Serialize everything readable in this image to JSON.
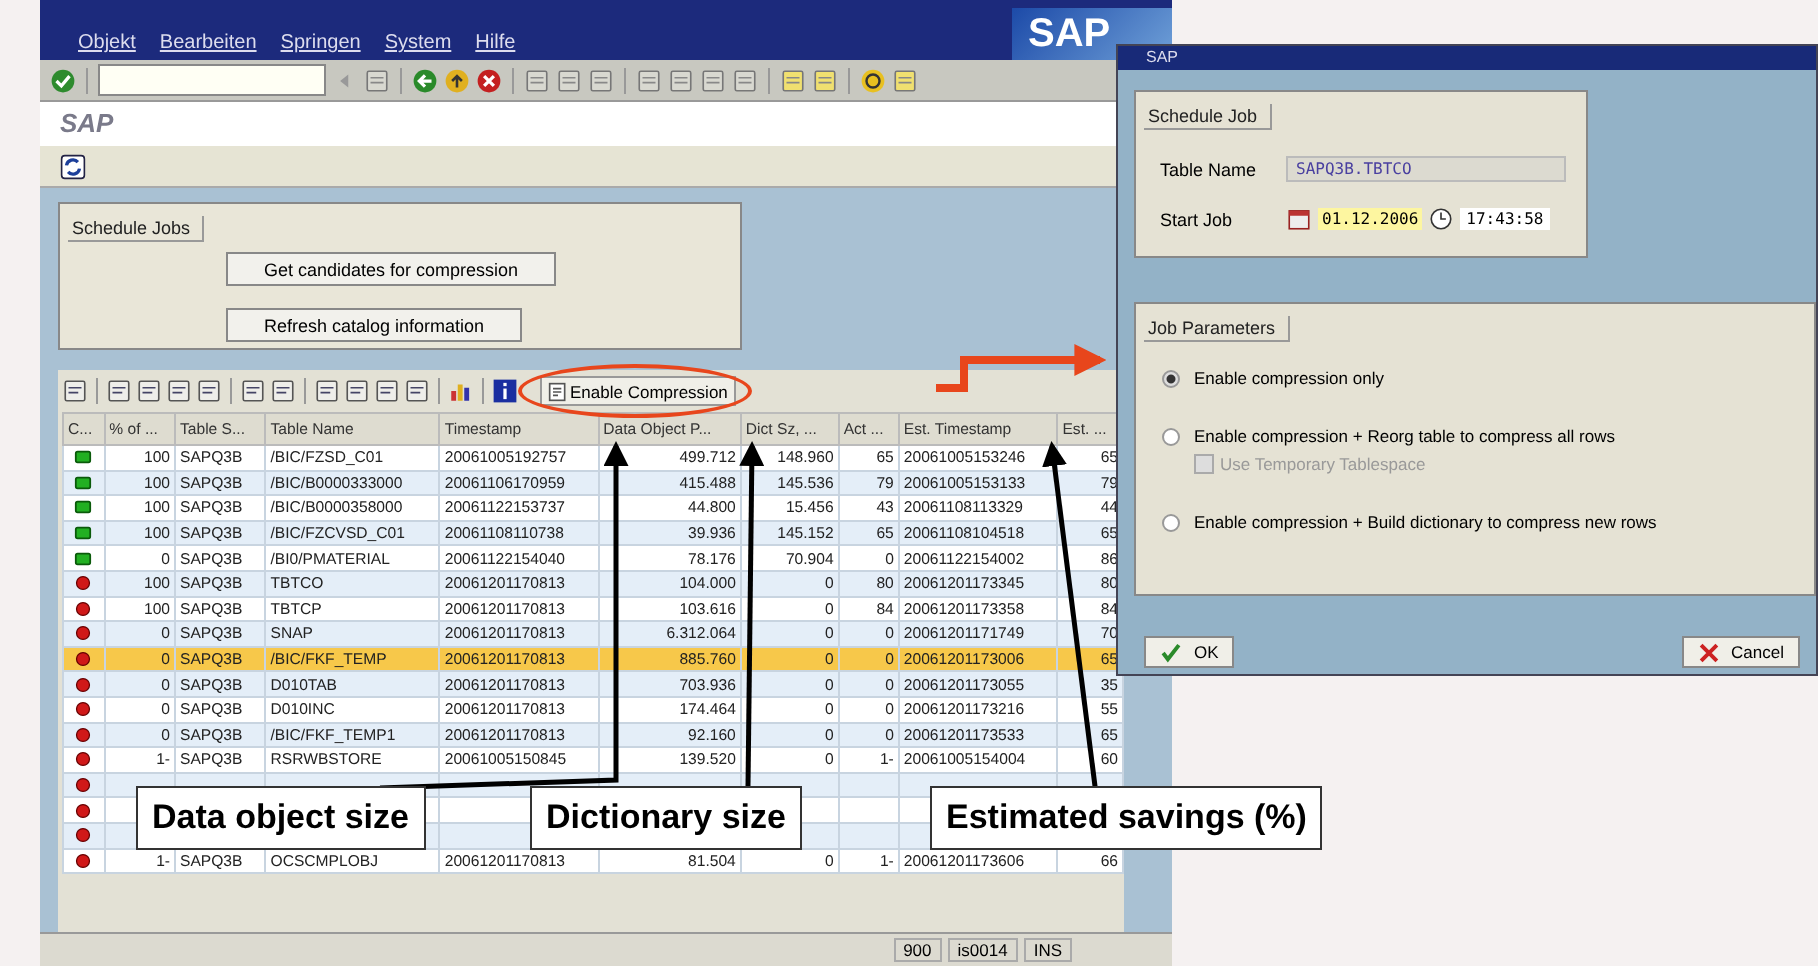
{
  "main_window": {
    "menu": [
      "Objekt",
      "Bearbeiten",
      "Springen",
      "System",
      "Hilfe"
    ],
    "logo": "SAP",
    "title": "SAP",
    "group": {
      "title": "Schedule Jobs",
      "buttons": [
        "Get candidates for compression",
        "Refresh catalog information"
      ]
    },
    "table_toolbar": {
      "action": "Enable Compression"
    },
    "table": {
      "columns": [
        "C...",
        "% of ...",
        "Table S...",
        "Table Name",
        "Timestamp",
        "Data Object P...",
        "Dict Sz, ...",
        "Act ...",
        "Est. Timestamp",
        "Est. ..."
      ],
      "rows": [
        {
          "kind": "ok",
          "selected": false,
          "cells": [
            "100",
            "SAPQ3B",
            "/BIC/FZSD_C01",
            "20061005192757",
            "499.712",
            "148.960",
            "65",
            "20061005153246",
            "65"
          ]
        },
        {
          "kind": "ok",
          "selected": false,
          "cells": [
            "100",
            "SAPQ3B",
            "/BIC/B0000333000",
            "20061106170959",
            "415.488",
            "145.536",
            "79",
            "20061005153133",
            "79"
          ]
        },
        {
          "kind": "ok",
          "selected": false,
          "cells": [
            "100",
            "SAPQ3B",
            "/BIC/B0000358000",
            "20061122153737",
            "44.800",
            "15.456",
            "43",
            "20061108113329",
            "44"
          ]
        },
        {
          "kind": "ok",
          "selected": false,
          "cells": [
            "100",
            "SAPQ3B",
            "/BIC/FZCVSD_C01",
            "20061108110738",
            "39.936",
            "145.152",
            "65",
            "20061108104518",
            "65"
          ]
        },
        {
          "kind": "ok",
          "selected": false,
          "cells": [
            "0",
            "SAPQ3B",
            "/BI0/PMATERIAL",
            "20061122154040",
            "78.176",
            "70.904",
            "0",
            "20061122154002",
            "86"
          ]
        },
        {
          "kind": "error",
          "selected": false,
          "cells": [
            "100",
            "SAPQ3B",
            "TBTCO",
            "20061201170813",
            "104.000",
            "0",
            "80",
            "20061201173345",
            "80"
          ]
        },
        {
          "kind": "error",
          "selected": false,
          "cells": [
            "100",
            "SAPQ3B",
            "TBTCP",
            "20061201170813",
            "103.616",
            "0",
            "84",
            "20061201173358",
            "84"
          ]
        },
        {
          "kind": "error",
          "selected": false,
          "cells": [
            "0",
            "SAPQ3B",
            "SNAP",
            "20061201170813",
            "6.312.064",
            "0",
            "0",
            "20061201171749",
            "70"
          ]
        },
        {
          "kind": "error",
          "selected": true,
          "cells": [
            "0",
            "SAPQ3B",
            "/BIC/FKF_TEMP",
            "20061201170813",
            "885.760",
            "0",
            "0",
            "20061201173006",
            "65"
          ]
        },
        {
          "kind": "error",
          "selected": false,
          "cells": [
            "0",
            "SAPQ3B",
            "D010TAB",
            "20061201170813",
            "703.936",
            "0",
            "0",
            "20061201173055",
            "35"
          ]
        },
        {
          "kind": "error",
          "selected": false,
          "cells": [
            "0",
            "SAPQ3B",
            "D010INC",
            "20061201170813",
            "174.464",
            "0",
            "0",
            "20061201173216",
            "55"
          ]
        },
        {
          "kind": "error",
          "selected": false,
          "cells": [
            "0",
            "SAPQ3B",
            "/BIC/FKF_TEMP1",
            "20061201170813",
            "92.160",
            "0",
            "0",
            "20061201173533",
            "65"
          ]
        },
        {
          "kind": "error",
          "selected": false,
          "cells": [
            "1-",
            "SAPQ3B",
            "RSRWBSTORE",
            "20061005150845",
            "139.520",
            "0",
            "1-",
            "20061005154004",
            "60"
          ]
        },
        {
          "kind": "error",
          "selected": false
        },
        {
          "kind": "error",
          "selected": false
        },
        {
          "kind": "error",
          "selected": false
        },
        {
          "kind": "error",
          "selected": false,
          "cells": [
            "1-",
            "SAPQ3B",
            "OCSCMPLOBJ",
            "20061201170813",
            "81.504",
            "0",
            "1-",
            "20061201173606",
            "66"
          ]
        }
      ]
    },
    "status_bar": [
      "900",
      "is0014",
      "INS"
    ]
  },
  "dialog": {
    "title": "SAP",
    "schedule": {
      "title": "Schedule Job",
      "table_label": "Table Name",
      "table_value": "SAPQ3B.TBTCO",
      "start_label": "Start Job",
      "date": "01.12.2006",
      "time": "17:43:58"
    },
    "params": {
      "title": "Job Parameters",
      "options": [
        {
          "label": "Enable compression only",
          "selected": true
        },
        {
          "label": "Enable compression + Reorg table to compress all rows",
          "selected": false,
          "sub": {
            "label": "Use Temporary Tablespace",
            "checked": false,
            "disabled": true
          }
        },
        {
          "label": "Enable compression + Build dictionary to compress new rows",
          "selected": false
        }
      ]
    },
    "buttons": [
      {
        "kind": "ok",
        "label": "OK"
      },
      {
        "kind": "cancel",
        "label": "Cancel"
      }
    ]
  },
  "callouts": [
    "Data object size",
    "Dictionary size",
    "Estimated savings (%)"
  ]
}
